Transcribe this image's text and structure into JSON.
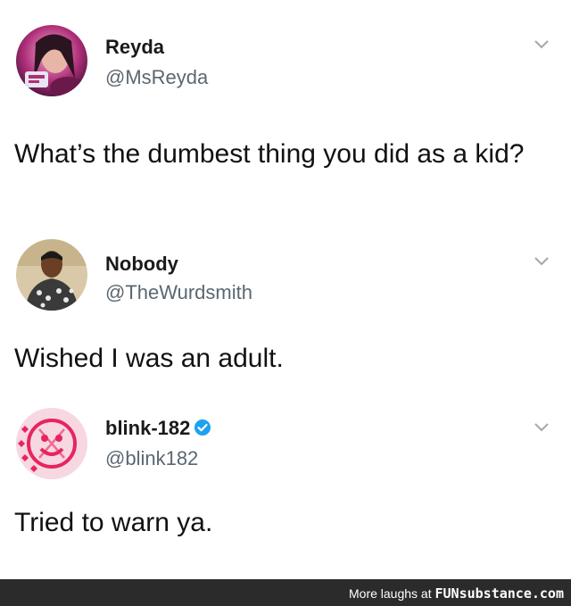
{
  "tweets": [
    {
      "name": "Reyda",
      "handle": "@MsReyda",
      "text": "What’s the dumbest thing you did as a kid?",
      "avatar_icon": "profile-photo-woman-pink-light",
      "menu_icon": "chevron-down-icon"
    },
    {
      "name": "Nobody",
      "handle": "@TheWurdsmith",
      "text": "Wished I was an adult.",
      "avatar_icon": "profile-photo-man-patterned-shirt",
      "menu_icon": "chevron-down-icon"
    },
    {
      "name": "blink-182",
      "handle": "@blink182",
      "text": "Tried to warn ya.",
      "verified": true,
      "avatar_icon": "blink-182-smiley-logo",
      "menu_icon": "chevron-down-icon"
    }
  ],
  "footer": {
    "prefix": "More laughs at ",
    "brand": "FUNsubstance.com"
  },
  "colors": {
    "verified_blue": "#1da1f2",
    "handle_gray": "#5b6770",
    "footer_bg": "#2b2b2b",
    "blink_pink": "#e8245f"
  }
}
